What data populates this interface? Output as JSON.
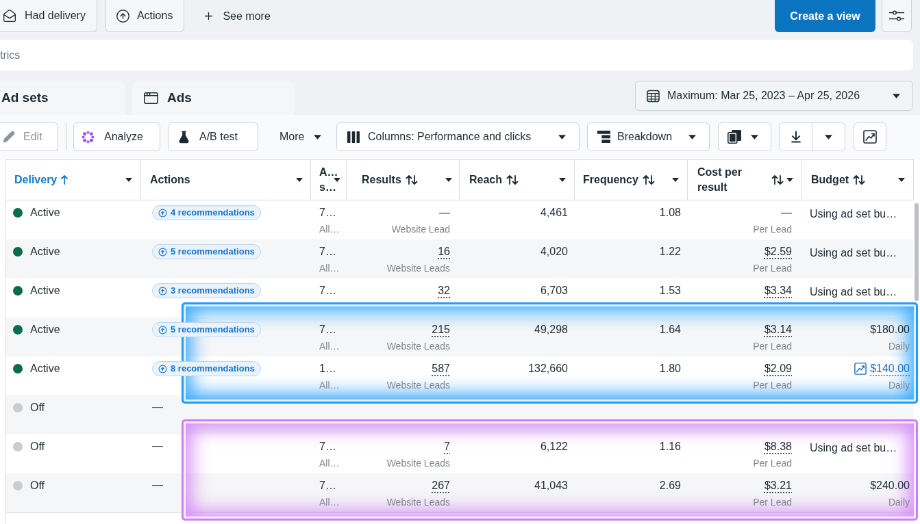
{
  "filters": {
    "had_delivery": {
      "label": "Had delivery"
    },
    "actions": {
      "label": "Actions"
    },
    "see_more": {
      "label": "See more"
    }
  },
  "create_view": {
    "label": "Create a view"
  },
  "search": {
    "placeholder": "trics"
  },
  "tabs": [
    {
      "kind": "clipped",
      "label": "Ad sets",
      "selected": false
    },
    {
      "kind": "full",
      "label": "Ads",
      "selected": false
    }
  ],
  "date_range": {
    "label": "Maximum: Mar 25, 2023 – Apr 25, 2026"
  },
  "toolbar": {
    "edit": {
      "label": "Edit",
      "disabled": true
    },
    "analyze": {
      "label": "Analyze"
    },
    "ab_test": {
      "label": "A/B test"
    },
    "more": {
      "label": "More"
    },
    "columns": {
      "label": "Columns: Performance and clicks"
    },
    "breakdown": {
      "label": "Breakdown"
    }
  },
  "table": {
    "columns": [
      {
        "label": "Delivery",
        "sortable": true,
        "sorted": true
      },
      {
        "label": "Actions",
        "sortable": false,
        "sorted": false
      },
      {
        "label": "A… s…",
        "sortable": false,
        "sorted": false
      },
      {
        "label": "Results",
        "sortable": true,
        "sorted": false
      },
      {
        "label": "Reach",
        "sortable": true,
        "sorted": false
      },
      {
        "label": "Frequency",
        "sortable": true,
        "sorted": false
      },
      {
        "label": "Cost per result",
        "sortable": true,
        "sorted": false
      },
      {
        "label": "Budget",
        "sortable": true,
        "sorted": false
      }
    ],
    "row_groups": [
      {
        "rows": [
          {
            "delivery": {
              "status": "Active",
              "color": "#0b6b4b"
            },
            "actions": {
              "kind": "pill",
              "text": "4 recommendations"
            },
            "column_3": {
              "value": "7…",
              "sub": "All…"
            },
            "results": {
              "value": "—",
              "unit": "Website Lead",
              "underlined": false
            },
            "reach": "4,461",
            "frequency": "1.08",
            "cost": {
              "value": "—",
              "unit": "Per Lead",
              "underlined": false
            },
            "budget": {
              "kind": "note",
              "value": "Using ad set bu…"
            }
          },
          {
            "delivery": {
              "status": "Active",
              "color": "#0b6b4b"
            },
            "actions": {
              "kind": "pill",
              "text": "5 recommendations"
            },
            "column_3": {
              "value": "7…",
              "sub": "All…"
            },
            "results": {
              "value": "16",
              "unit": "Website Leads",
              "underlined": true
            },
            "reach": "4,020",
            "frequency": "1.22",
            "cost": {
              "value": "$2.59",
              "unit": "Per Lead",
              "underlined": true
            },
            "budget": {
              "kind": "note",
              "value": "Using ad set bu…"
            }
          },
          {
            "delivery": {
              "status": "Active",
              "color": "#0b6b4b"
            },
            "actions": {
              "kind": "pill",
              "text": "3 recommendations"
            },
            "column_3": {
              "value": "7…"
            },
            "results": {
              "value": "32",
              "underlined": true
            },
            "reach": "6,703",
            "frequency": "1.53",
            "cost": {
              "value": "$3.34",
              "underlined": true
            },
            "budget": {
              "kind": "note",
              "value": "Using ad set bu…"
            }
          }
        ]
      },
      {
        "frame": {
          "color": "#1f9dff"
        },
        "rows": [
          {
            "delivery": {
              "status": "Active",
              "color": "#0b6b4b"
            },
            "actions": {
              "kind": "pill",
              "text": "5 recommendations"
            },
            "column_3": {
              "value": "7…",
              "sub": "All…"
            },
            "results": {
              "value": "215",
              "unit": "Website Leads",
              "underlined": true
            },
            "reach": "49,298",
            "frequency": "1.64",
            "cost": {
              "value": "$3.14",
              "unit": "Per Lead",
              "underlined": true
            },
            "budget": {
              "kind": "amount",
              "value": "$180.00",
              "period": "Daily"
            }
          },
          {
            "delivery": {
              "status": "Active",
              "color": "#0b6b4b"
            },
            "actions": {
              "kind": "pill",
              "text": "8 recommendations"
            },
            "column_3": {
              "value": "1…",
              "sub": "All…"
            },
            "results": {
              "value": "587",
              "unit": "Website Leads",
              "underlined": true
            },
            "reach": "132,660",
            "frequency": "1.80",
            "cost": {
              "value": "$2.09",
              "unit": "Per Lead",
              "underlined": true
            },
            "budget": {
              "kind": "trend",
              "value": "$140.00",
              "period": "Daily"
            }
          }
        ]
      },
      {
        "rows": [
          {
            "delivery": {
              "status": "Off",
              "color": "#c9ccd1"
            },
            "actions": {
              "kind": "dash",
              "text": "—"
            }
          }
        ]
      },
      {
        "frame": {
          "color": "#d07ef7"
        },
        "rows": [
          {
            "delivery": {
              "status": "Off",
              "color": "#c9ccd1"
            },
            "actions": {
              "kind": "dash",
              "text": "—"
            },
            "column_3": {
              "value": "7…",
              "sub": "All…"
            },
            "results": {
              "value": "7",
              "unit": "Website Leads",
              "underlined": true
            },
            "reach": "6,122",
            "frequency": "1.16",
            "cost": {
              "value": "$8.38",
              "unit": "Per Lead",
              "underlined": true
            },
            "budget": {
              "kind": "note",
              "value": "Using ad set bu…"
            }
          },
          {
            "delivery": {
              "status": "Off",
              "color": "#c9ccd1"
            },
            "actions": {
              "kind": "dash",
              "text": "—"
            },
            "column_3": {
              "value": "7…",
              "sub": "All…"
            },
            "results": {
              "value": "267",
              "unit": "Website Leads",
              "underlined": true
            },
            "reach": "41,043",
            "frequency": "2.69",
            "cost": {
              "value": "$3.21",
              "unit": "Per Lead",
              "underlined": true
            },
            "budget": {
              "kind": "amount",
              "value": "$240.00",
              "period": "Daily"
            }
          }
        ]
      }
    ]
  }
}
